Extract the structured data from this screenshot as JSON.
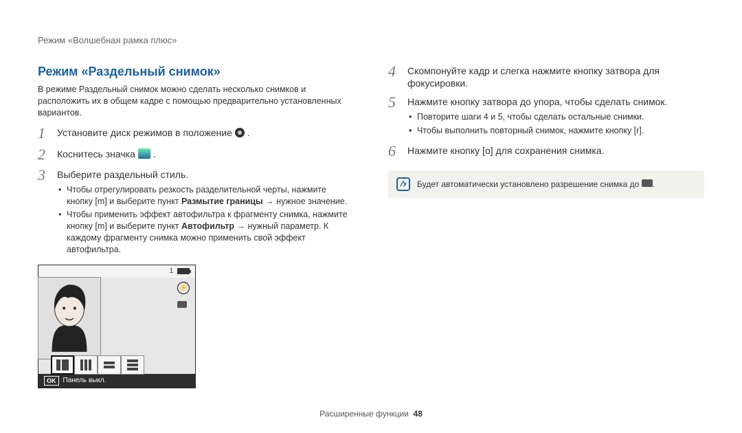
{
  "running_head": "Режим «Волшебная рамка плюс»",
  "section_title": "Режим «Раздельный снимок»",
  "intro": "В режиме Раздельный снимок можно сделать несколько снимков и расположить их в общем кадре с помощью предварительно установленных вариантов.",
  "left_steps": [
    {
      "num": "1",
      "text_before": "Установите диск режимов в положение ",
      "text_after": "."
    },
    {
      "num": "2",
      "text_before": "Коснитесь значка ",
      "text_after": "."
    },
    {
      "num": "3",
      "text_before": "Выберите раздельный стиль.",
      "text_after": ""
    }
  ],
  "sub3": [
    {
      "pre": "Чтобы отрегулировать резкость разделительной черты, нажмите кнопку [",
      "btn": "m",
      "mid": "] и выберите пункт ",
      "bold": "Размытие границы",
      "post": " → нужное значение."
    },
    {
      "pre": "Чтобы применить эффект автофильтра к фрагменту снимка, нажмите кнопку [",
      "btn": "m",
      "mid": "] и выберите пункт ",
      "bold": "Автофильтр",
      "post": " → нужный параметр. К каждому фрагменту снимка можно применить свой эффект автофильтра."
    }
  ],
  "preview_top_count": "1",
  "preview_footer_ok": "OK",
  "preview_footer_text": "Панель выкл.",
  "right_steps": [
    {
      "num": "4",
      "text": "Скомпонуйте кадр и слегка нажмите кнопку затвора для фокусировки."
    },
    {
      "num": "5",
      "text": "Нажмите кнопку затвора до упора, чтобы сделать снимок."
    }
  ],
  "sub5": [
    {
      "text": "Повторите шаги 4 и 5, чтобы сделать остальные снимки."
    },
    {
      "pre": "Чтобы выполнить повторный снимок, нажмите кнопку [",
      "btn": "r",
      "post": "]."
    }
  ],
  "right_step6": {
    "num": "6",
    "pre": "Нажмите кнопку [",
    "btn": "o",
    "post": "] для сохранения снимка."
  },
  "note": {
    "pre": "Будет автоматически установлено разрешение снимка до ",
    "post": "."
  },
  "footer": {
    "section": "Расширенные функции",
    "page": "48"
  }
}
